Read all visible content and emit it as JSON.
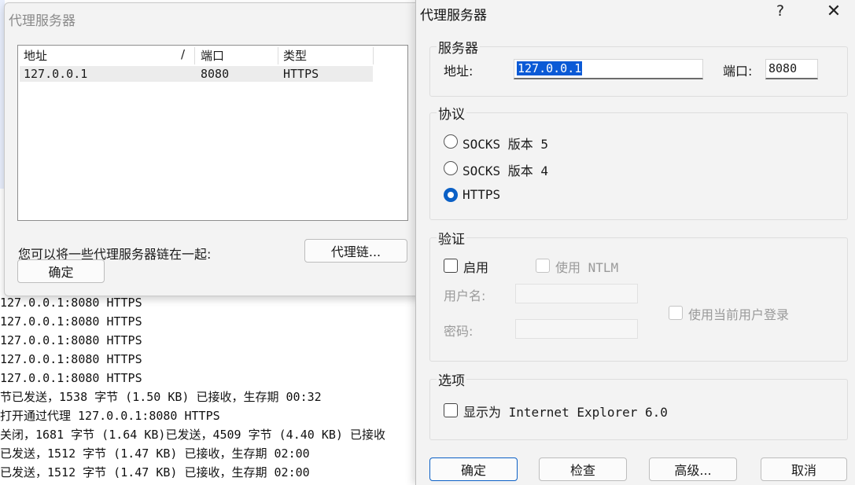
{
  "log": {
    "lines": [
      "127.0.0.1:8080 HTTPS",
      "127.0.0.1:8080 HTTPS",
      "127.0.0.1:8080 HTTPS",
      "127.0.0.1:8080 HTTPS",
      "127.0.0.1:8080 HTTPS",
      "节已发送，1538 字节 (1.50 KB) 已接收，生存期 00:32",
      "打开通过代理 127.0.0.1:8080 HTTPS",
      "关闭，1681 字节 (1.64 KB)已发送，4509 字节 (4.40 KB) 已接收",
      "已发送，1512 字节 (1.47 KB) 已接收，生存期 02:00",
      "已发送，1512 字节 (1.47 KB) 已接收，生存期 02:00"
    ]
  },
  "back_dialog": {
    "title": "代理服务器",
    "table": {
      "columns": [
        "地址",
        "/",
        "端口",
        "类型"
      ],
      "rows": [
        {
          "address": "127.0.0.1",
          "port": "8080",
          "type": "HTTPS"
        }
      ]
    },
    "chain_note": "您可以将一些代理服务器链在一起:",
    "chain_button": "代理链...",
    "ok_button": "确定"
  },
  "dialog": {
    "title": "代理服务器",
    "help": "?",
    "close": "✕",
    "server": {
      "label": "服务器",
      "address_label": "地址:",
      "address_value": "127.0.0.1",
      "port_label": "端口:",
      "port_value": "8080"
    },
    "protocol": {
      "label": "协议",
      "options": [
        "SOCKS 版本 5",
        "SOCKS 版本 4",
        "HTTPS"
      ],
      "selected": "HTTPS"
    },
    "auth": {
      "label": "验证",
      "enable": "启用",
      "use_ntlm": "使用 NTLM",
      "username_label": "用户名:",
      "password_label": "密码:",
      "current_user": "使用当前用户登录"
    },
    "options": {
      "label": "选项",
      "show_as_ie": "显示为 Internet Explorer 6.0"
    },
    "buttons": {
      "ok": "确定",
      "check": "检查",
      "advanced": "高级...",
      "cancel": "取消"
    }
  }
}
